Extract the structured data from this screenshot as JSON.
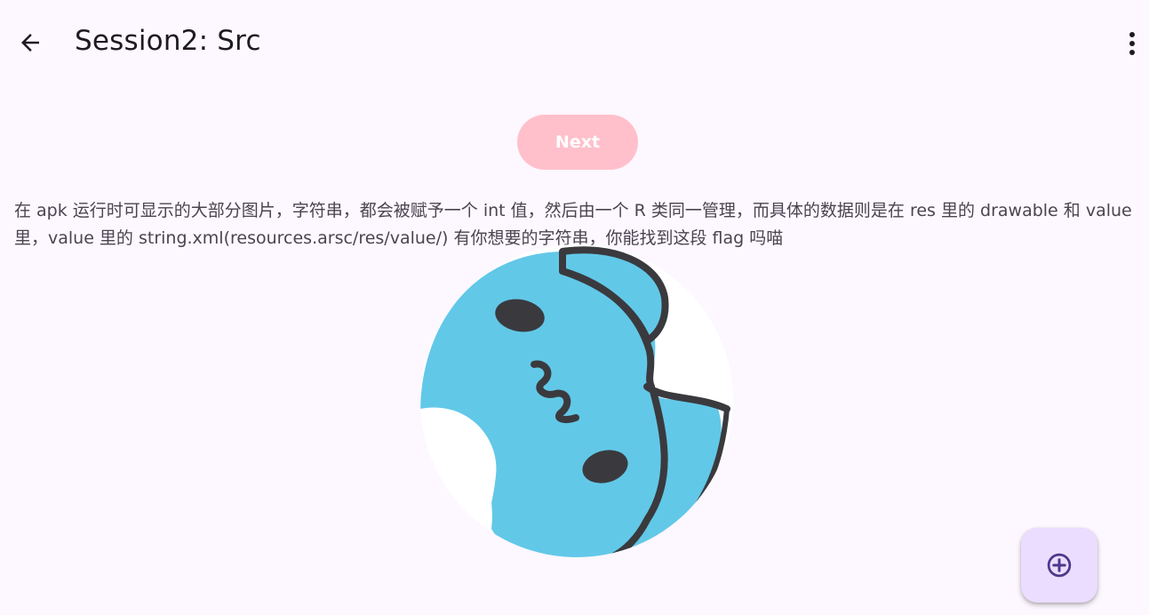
{
  "app_bar": {
    "title": "Session2: Src",
    "back_icon": "arrow-back-icon",
    "overflow_icon": "more-vert-icon"
  },
  "main": {
    "next_button_label": "Next",
    "description": "在 apk 运行时可显示的大部分图片，字符串，都会被赋予一个 int 值，然后由一个 R 类同一管理，而具体的数据则是在 res 里的 drawable 和 value 里，value 里的 string.xml(resources.arsc/res/value/) 有你想要的字符串，你能找到这段 flag 吗喵",
    "image_icon": "blue-cat-sticker-image"
  },
  "fab": {
    "icon": "add-circle-icon"
  },
  "colors": {
    "background": "#fdf7ff",
    "next_button": "#ffc0cb",
    "fab_background": "#eaddff",
    "fab_icon": "#4f378b",
    "cat_blue": "#62c8e8",
    "cat_outline": "#3a3a3e"
  }
}
